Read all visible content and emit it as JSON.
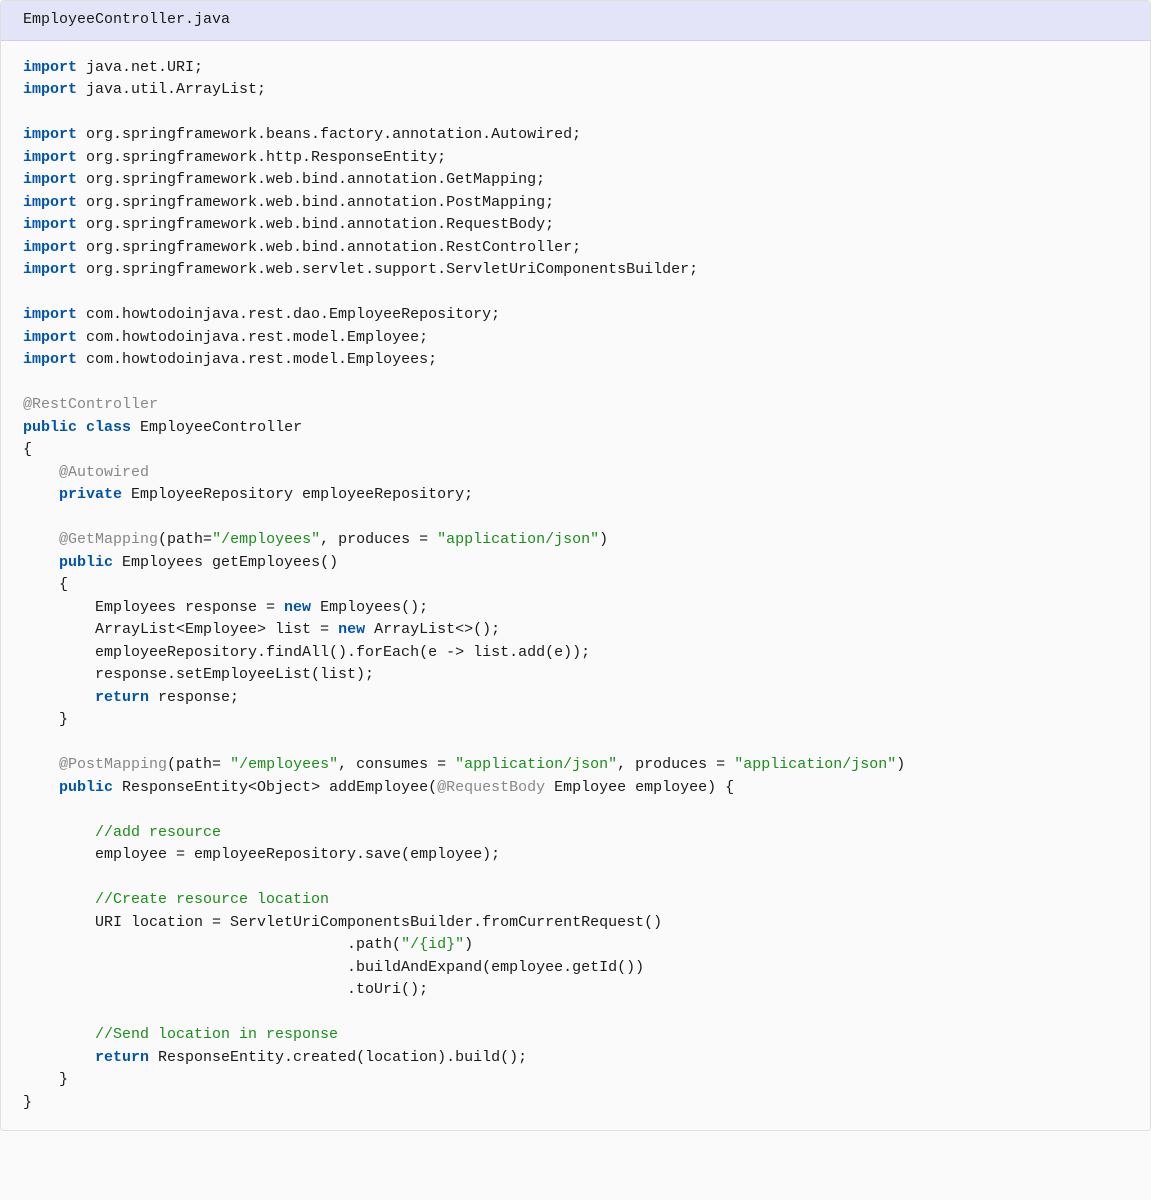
{
  "filename": "EmployeeController.java",
  "code": {
    "lines": [
      [
        {
          "t": "keyword",
          "v": "import"
        },
        {
          "t": "plain",
          "v": " java.net.URI;"
        }
      ],
      [
        {
          "t": "keyword",
          "v": "import"
        },
        {
          "t": "plain",
          "v": " java.util.ArrayList;"
        }
      ],
      [],
      [
        {
          "t": "keyword",
          "v": "import"
        },
        {
          "t": "plain",
          "v": " org.springframework.beans.factory.annotation.Autowired;"
        }
      ],
      [
        {
          "t": "keyword",
          "v": "import"
        },
        {
          "t": "plain",
          "v": " org.springframework.http.ResponseEntity;"
        }
      ],
      [
        {
          "t": "keyword",
          "v": "import"
        },
        {
          "t": "plain",
          "v": " org.springframework.web.bind.annotation.GetMapping;"
        }
      ],
      [
        {
          "t": "keyword",
          "v": "import"
        },
        {
          "t": "plain",
          "v": " org.springframework.web.bind.annotation.PostMapping;"
        }
      ],
      [
        {
          "t": "keyword",
          "v": "import"
        },
        {
          "t": "plain",
          "v": " org.springframework.web.bind.annotation.RequestBody;"
        }
      ],
      [
        {
          "t": "keyword",
          "v": "import"
        },
        {
          "t": "plain",
          "v": " org.springframework.web.bind.annotation.RestController;"
        }
      ],
      [
        {
          "t": "keyword",
          "v": "import"
        },
        {
          "t": "plain",
          "v": " org.springframework.web.servlet.support.ServletUriComponentsBuilder;"
        }
      ],
      [],
      [
        {
          "t": "keyword",
          "v": "import"
        },
        {
          "t": "plain",
          "v": " com.howtodoinjava.rest.dao.EmployeeRepository;"
        }
      ],
      [
        {
          "t": "keyword",
          "v": "import"
        },
        {
          "t": "plain",
          "v": " com.howtodoinjava.rest.model.Employee;"
        }
      ],
      [
        {
          "t": "keyword",
          "v": "import"
        },
        {
          "t": "plain",
          "v": " com.howtodoinjava.rest.model.Employees;"
        }
      ],
      [],
      [
        {
          "t": "annotation",
          "v": "@RestController"
        }
      ],
      [
        {
          "t": "keyword",
          "v": "public"
        },
        {
          "t": "plain",
          "v": " "
        },
        {
          "t": "keyword",
          "v": "class"
        },
        {
          "t": "plain",
          "v": " EmployeeController"
        }
      ],
      [
        {
          "t": "plain",
          "v": "{"
        }
      ],
      [
        {
          "t": "plain",
          "v": "    "
        },
        {
          "t": "annotation",
          "v": "@Autowired"
        }
      ],
      [
        {
          "t": "plain",
          "v": "    "
        },
        {
          "t": "keyword",
          "v": "private"
        },
        {
          "t": "plain",
          "v": " EmployeeRepository employeeRepository;"
        }
      ],
      [],
      [
        {
          "t": "plain",
          "v": "    "
        },
        {
          "t": "annotation",
          "v": "@GetMapping"
        },
        {
          "t": "plain",
          "v": "(path="
        },
        {
          "t": "string",
          "v": "\"/employees\""
        },
        {
          "t": "plain",
          "v": ", produces = "
        },
        {
          "t": "string",
          "v": "\"application/json\""
        },
        {
          "t": "plain",
          "v": ")"
        }
      ],
      [
        {
          "t": "plain",
          "v": "    "
        },
        {
          "t": "keyword",
          "v": "public"
        },
        {
          "t": "plain",
          "v": " Employees getEmployees()"
        }
      ],
      [
        {
          "t": "plain",
          "v": "    {"
        }
      ],
      [
        {
          "t": "plain",
          "v": "        Employees response = "
        },
        {
          "t": "keyword",
          "v": "new"
        },
        {
          "t": "plain",
          "v": " Employees();"
        }
      ],
      [
        {
          "t": "plain",
          "v": "        ArrayList<Employee> list = "
        },
        {
          "t": "keyword",
          "v": "new"
        },
        {
          "t": "plain",
          "v": " ArrayList<>();"
        }
      ],
      [
        {
          "t": "plain",
          "v": "        employeeRepository.findAll().forEach(e -> list.add(e));"
        }
      ],
      [
        {
          "t": "plain",
          "v": "        response.setEmployeeList(list);"
        }
      ],
      [
        {
          "t": "plain",
          "v": "        "
        },
        {
          "t": "keyword",
          "v": "return"
        },
        {
          "t": "plain",
          "v": " response;"
        }
      ],
      [
        {
          "t": "plain",
          "v": "    }"
        }
      ],
      [],
      [
        {
          "t": "plain",
          "v": "    "
        },
        {
          "t": "annotation",
          "v": "@PostMapping"
        },
        {
          "t": "plain",
          "v": "(path= "
        },
        {
          "t": "string",
          "v": "\"/employees\""
        },
        {
          "t": "plain",
          "v": ", consumes = "
        },
        {
          "t": "string",
          "v": "\"application/json\""
        },
        {
          "t": "plain",
          "v": ", produces = "
        },
        {
          "t": "string",
          "v": "\"application/json\""
        },
        {
          "t": "plain",
          "v": ")"
        }
      ],
      [
        {
          "t": "plain",
          "v": "    "
        },
        {
          "t": "keyword",
          "v": "public"
        },
        {
          "t": "plain",
          "v": " ResponseEntity<Object> addEmployee("
        },
        {
          "t": "annotation",
          "v": "@RequestBody"
        },
        {
          "t": "plain",
          "v": " Employee employee) {"
        }
      ],
      [],
      [
        {
          "t": "plain",
          "v": "        "
        },
        {
          "t": "comment",
          "v": "//add resource"
        }
      ],
      [
        {
          "t": "plain",
          "v": "        employee = employeeRepository.save(employee);"
        }
      ],
      [],
      [
        {
          "t": "plain",
          "v": "        "
        },
        {
          "t": "comment",
          "v": "//Create resource location"
        }
      ],
      [
        {
          "t": "plain",
          "v": "        URI location = ServletUriComponentsBuilder.fromCurrentRequest()"
        }
      ],
      [
        {
          "t": "plain",
          "v": "                                    .path("
        },
        {
          "t": "string",
          "v": "\"/{id}\""
        },
        {
          "t": "plain",
          "v": ")"
        }
      ],
      [
        {
          "t": "plain",
          "v": "                                    .buildAndExpand(employee.getId())"
        }
      ],
      [
        {
          "t": "plain",
          "v": "                                    .toUri();"
        }
      ],
      [],
      [
        {
          "t": "plain",
          "v": "        "
        },
        {
          "t": "comment",
          "v": "//Send location in response"
        }
      ],
      [
        {
          "t": "plain",
          "v": "        "
        },
        {
          "t": "keyword",
          "v": "return"
        },
        {
          "t": "plain",
          "v": " ResponseEntity.created(location).build();"
        }
      ],
      [
        {
          "t": "plain",
          "v": "    }"
        }
      ],
      [
        {
          "t": "plain",
          "v": "}"
        }
      ]
    ]
  }
}
